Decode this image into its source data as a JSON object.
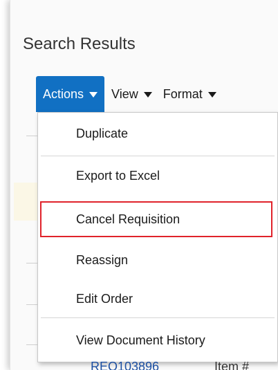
{
  "page": {
    "title": "Search Results"
  },
  "toolbar": {
    "actions_label": "Actions",
    "view_label": "View",
    "format_label": "Format"
  },
  "menu": {
    "items": [
      {
        "label": "Duplicate"
      },
      {
        "label": "Export to Excel"
      },
      {
        "label": "Cancel Requisition",
        "highlighted": true
      },
      {
        "label": "Reassign"
      },
      {
        "label": "Edit Order"
      },
      {
        "label": "View Document History"
      }
    ]
  },
  "results": {
    "partial_row": {
      "requisition": "REQ103896",
      "item": "Item #"
    }
  },
  "colors": {
    "accent": "#1170c3",
    "highlight_border": "#e0222a",
    "link": "#1c4fa2"
  }
}
